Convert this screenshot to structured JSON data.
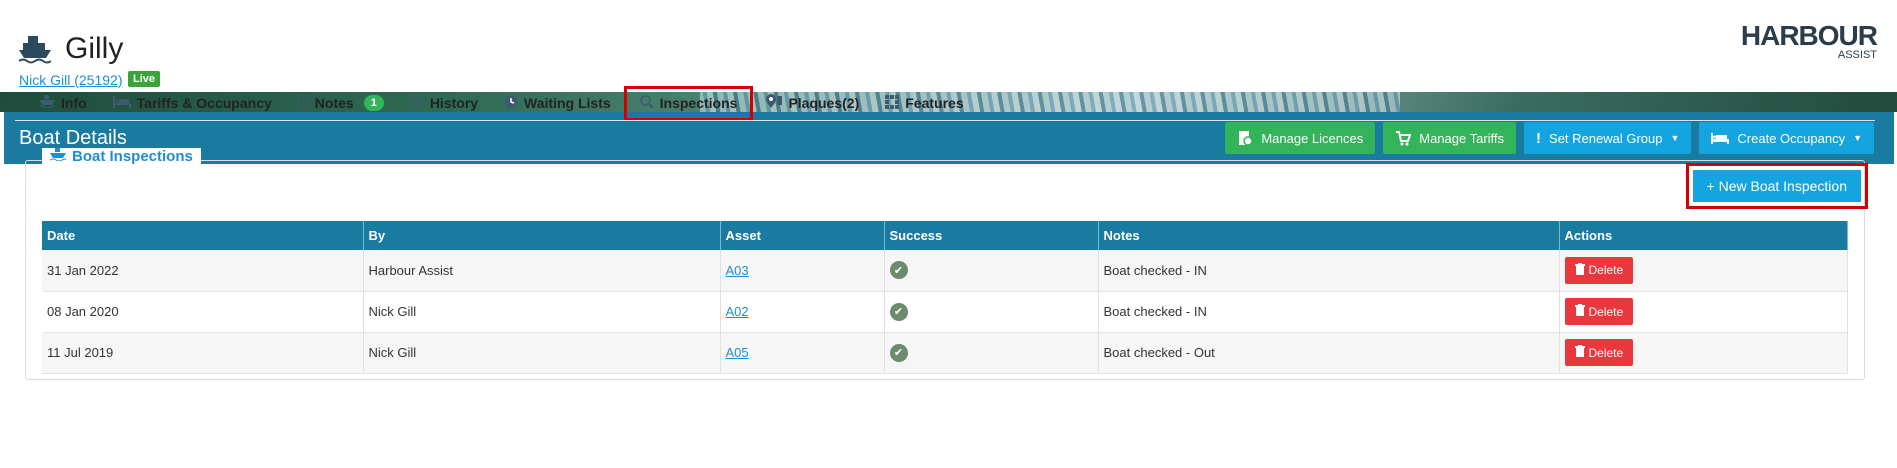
{
  "header": {
    "boat_name": "Gilly",
    "owner_link": "Nick Gill (25192)",
    "status_badge": "Live",
    "logo_main": "HARBOUR",
    "logo_sub": "ASSIST"
  },
  "panel": {
    "title": "Boat Details",
    "buttons": {
      "manage_licences": "Manage Licences",
      "manage_tariffs": "Manage Tariffs",
      "set_renewal_group": "Set Renewal Group",
      "create_occupancy": "Create Occupancy"
    }
  },
  "tabs": [
    {
      "label": "Info",
      "icon": "boat-icon"
    },
    {
      "label": "Tariffs & Occupancy",
      "icon": "bed-icon"
    },
    {
      "label": "Notes",
      "icon": "document-icon",
      "badge": "1"
    },
    {
      "label": "History",
      "icon": "history-icon"
    },
    {
      "label": "Waiting Lists",
      "icon": "clock-icon"
    },
    {
      "label": "Inspections",
      "icon": "search-icon",
      "active": true
    },
    {
      "label": "Plaques(2)",
      "icon": "map-marker-icon"
    },
    {
      "label": "Features",
      "icon": "grid-icon"
    }
  ],
  "inspections": {
    "section_title": "Boat Inspections",
    "new_button": "+ New Boat Inspection",
    "columns": [
      "Date",
      "By",
      "Asset",
      "Success",
      "Notes",
      "Actions"
    ],
    "rows": [
      {
        "date": "31 Jan 2022",
        "by": "Harbour Assist",
        "asset": "A03",
        "success": true,
        "notes": "Boat checked - IN",
        "action": "Delete"
      },
      {
        "date": "08 Jan 2020",
        "by": "Nick Gill",
        "asset": "A02",
        "success": true,
        "notes": "Boat checked - IN",
        "action": "Delete"
      },
      {
        "date": "11 Jul 2019",
        "by": "Nick Gill",
        "asset": "A05",
        "success": true,
        "notes": "Boat checked - Out",
        "action": "Delete"
      }
    ]
  },
  "colors": {
    "primary": "#1a7aa0",
    "green": "#33b35a",
    "blue": "#14a5e0",
    "danger": "#e8383d",
    "highlight": "#d40000"
  }
}
